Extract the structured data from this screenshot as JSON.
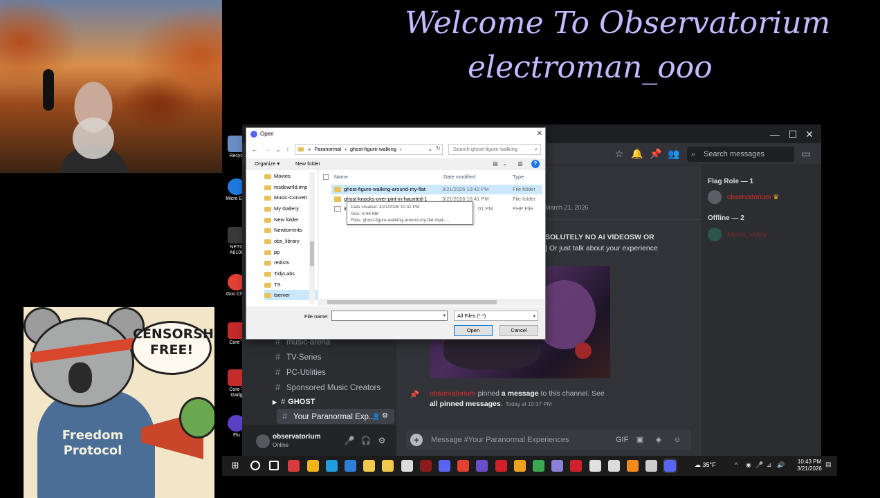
{
  "overlay": {
    "welcome_line1": "Welcome To Observatorium",
    "welcome_line2": "electroman_ooo",
    "poster_bubble": "CENSORSHIP FREE!",
    "poster_hoodie": "Freedom Protocol"
  },
  "desktop_icons": [
    {
      "label": "Recycl",
      "color": "#6a8fc7"
    },
    {
      "label": "Micro Edg",
      "color": "#1f7ae0"
    },
    {
      "label": "NETG A6100",
      "color": "#3a3a3a"
    },
    {
      "label": "Goo Chro",
      "color": "#e34133"
    },
    {
      "label": "Core T",
      "color": "#c42b2b"
    },
    {
      "label": "Core T Gadg",
      "color": "#c42b2b"
    },
    {
      "label": "Flu",
      "color": "#5b3fc4"
    }
  ],
  "dialog": {
    "title": "Open",
    "path_prefix": "«",
    "path_parts": [
      "Paranormal",
      "›",
      "ghost-figure-walking",
      "›"
    ],
    "search_placeholder": "Search ghost-figure-walking",
    "organize": "Organize ▾",
    "new_folder": "New folder",
    "tree_items": [
      "Movies",
      "msdownld.tmp",
      "Music-Convert",
      "My Gallery",
      "New folder",
      "Newtorrents",
      "obs_library",
      "pp",
      "redists",
      "TidyLabs",
      "TS",
      "tserver",
      "..."
    ],
    "columns": {
      "name": "Name",
      "date": "Date modified",
      "type": "Type"
    },
    "files": [
      {
        "name": "ghost-figure-walking-around-my-flat",
        "date": "3/21/2026 10:42 PM",
        "type": "File folder",
        "icon": "folder"
      },
      {
        "name": "ghost-knocks-over-pint-in-haunted-1",
        "date": "3/21/2026 10:41 PM",
        "type": "File folder",
        "icon": "folder"
      },
      {
        "name": "in",
        "date": "01 PM",
        "type": "PHP File",
        "icon": "php"
      }
    ],
    "tooltip": {
      "created": "Date created: 3/21/2026 10:42 PM",
      "size": "Size: 8.98 MB",
      "files": "Files: ghost-figure-walking-around-my-flat.mp4, ..."
    },
    "filename_label": "File name:",
    "filename_value": "",
    "filetype": "All Files (*.*)",
    "open_button": "Open",
    "cancel_button": "Cancel"
  },
  "discord": {
    "search_placeholder": "Search messages",
    "channels": [
      {
        "label": "music-arena"
      },
      {
        "label": "TV-Series"
      },
      {
        "label": "PC-Utilities"
      },
      {
        "label": "Sponsored Music Creators"
      }
    ],
    "category": "GHOST",
    "active_channel": "Your Paranormal Exp...",
    "user": {
      "name": "observatorium",
      "status": "Online"
    },
    "date_divider": "March 21, 2026",
    "rules_line1": "SOLUTELY NO AI VIDEOSW OR",
    "rules_line2": "] Or just talk about your experience",
    "pin": {
      "user": "observatorium",
      "text1": " pinned ",
      "message": "a message",
      "text2": " to this channel. See",
      "all": "all pinned messages",
      "suffix": ".",
      "time": "Today at 10:37 PM"
    },
    "message_placeholder": "Message #Your Paranormal Experiences",
    "members": {
      "online_header": "Flag Role — 1",
      "online_member": "observatorium",
      "offline_header": "Offline — 2",
      "offline_member": "Music_valley"
    },
    "colors": {
      "accent_red": "#e02a2a",
      "background": "#313338",
      "sidebar": "#2b2d31"
    }
  },
  "taskbar": {
    "apps": [
      {
        "name": "search-icon",
        "color": "#ffffff"
      },
      {
        "name": "task-view-icon",
        "color": "#ffffff"
      },
      {
        "name": "app-red-icon",
        "color": "#d83b3b"
      },
      {
        "name": "app-multicolor-icon",
        "color": "#f2b51d"
      },
      {
        "name": "edge-icon",
        "color": "#1f9de0"
      },
      {
        "name": "app-blue-icon",
        "color": "#2d7fd8"
      },
      {
        "name": "file-explorer-icon",
        "color": "#f2c94c"
      },
      {
        "name": "calendar-icon",
        "color": "#f2c94c"
      },
      {
        "name": "app-audio-icon",
        "color": "#dcdcdc"
      },
      {
        "name": "app-dark-red-icon",
        "color": "#8b1a1a"
      },
      {
        "name": "discord-icon",
        "color": "#5865f2"
      },
      {
        "name": "chrome-icon",
        "color": "#e34133"
      },
      {
        "name": "app-purple-icon",
        "color": "#6a4fc8"
      },
      {
        "name": "app-red-circle-icon",
        "color": "#d0202a"
      },
      {
        "name": "app-orange-icon",
        "color": "#f0a020"
      },
      {
        "name": "app-green-icon",
        "color": "#3aa84f"
      },
      {
        "name": "app-lavender-icon",
        "color": "#8c7fd8"
      },
      {
        "name": "opera-icon",
        "color": "#d0202a"
      },
      {
        "name": "obs-icon",
        "color": "#e0e0e0"
      },
      {
        "name": "app-box-icon",
        "color": "#dcdcdc"
      },
      {
        "name": "vlc-icon",
        "color": "#f08a1c"
      },
      {
        "name": "settings-icon",
        "color": "#cccccc"
      },
      {
        "name": "discord-active-icon",
        "color": "#5865f2"
      }
    ],
    "weather": "35°F",
    "time": "10:43 PM",
    "date": "3/21/2026"
  }
}
